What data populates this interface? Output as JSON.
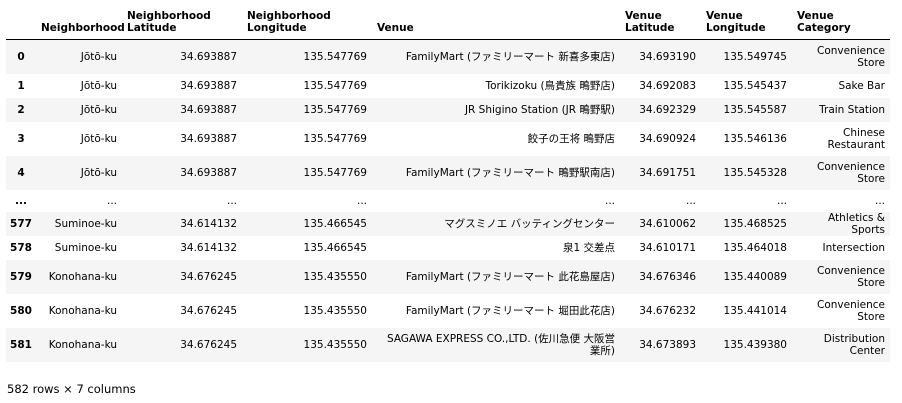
{
  "table": {
    "columns": [
      "",
      "Neighborhood",
      "Neighborhood Latitude",
      "Neighborhood Longitude",
      "Venue",
      "Venue Latitude",
      "Venue Longitude",
      "Venue Category"
    ],
    "rows": [
      {
        "idx": "0",
        "neighborhood": "Jōtō-ku",
        "n_lat": "34.693887",
        "n_lon": "135.547769",
        "venue": "FamilyMart (ファミリーマート 新喜多東店)",
        "v_lat": "34.693190",
        "v_lon": "135.549745",
        "category": "Convenience Store"
      },
      {
        "idx": "1",
        "neighborhood": "Jōtō-ku",
        "n_lat": "34.693887",
        "n_lon": "135.547769",
        "venue": "Torikizoku (鳥貴族 鴫野店)",
        "v_lat": "34.692083",
        "v_lon": "135.545437",
        "category": "Sake Bar"
      },
      {
        "idx": "2",
        "neighborhood": "Jōtō-ku",
        "n_lat": "34.693887",
        "n_lon": "135.547769",
        "venue": "JR Shigino Station (JR 鴫野駅)",
        "v_lat": "34.692329",
        "v_lon": "135.545587",
        "category": "Train Station"
      },
      {
        "idx": "3",
        "neighborhood": "Jōtō-ku",
        "n_lat": "34.693887",
        "n_lon": "135.547769",
        "venue": "餃子の王将 鴫野店",
        "v_lat": "34.690924",
        "v_lon": "135.546136",
        "category": "Chinese Restaurant"
      },
      {
        "idx": "4",
        "neighborhood": "Jōtō-ku",
        "n_lat": "34.693887",
        "n_lon": "135.547769",
        "venue": "FamilyMart (ファミリーマート 鴫野駅南店)",
        "v_lat": "34.691751",
        "v_lon": "135.545328",
        "category": "Convenience Store"
      },
      {
        "idx": "...",
        "neighborhood": "...",
        "n_lat": "...",
        "n_lon": "...",
        "venue": "...",
        "v_lat": "...",
        "v_lon": "...",
        "category": "..."
      },
      {
        "idx": "577",
        "neighborhood": "Suminoe-ku",
        "n_lat": "34.614132",
        "n_lon": "135.466545",
        "venue": "マグスミノエ バッティングセンター",
        "v_lat": "34.610062",
        "v_lon": "135.468525",
        "category": "Athletics & Sports"
      },
      {
        "idx": "578",
        "neighborhood": "Suminoe-ku",
        "n_lat": "34.614132",
        "n_lon": "135.466545",
        "venue": "泉1 交差点",
        "v_lat": "34.610171",
        "v_lon": "135.464018",
        "category": "Intersection"
      },
      {
        "idx": "579",
        "neighborhood": "Konohana-ku",
        "n_lat": "34.676245",
        "n_lon": "135.435550",
        "venue": "FamilyMart (ファミリーマート 此花島屋店)",
        "v_lat": "34.676346",
        "v_lon": "135.440089",
        "category": "Convenience Store"
      },
      {
        "idx": "580",
        "neighborhood": "Konohana-ku",
        "n_lat": "34.676245",
        "n_lon": "135.435550",
        "venue": "FamilyMart (ファミリーマート 堀田此花店)",
        "v_lat": "34.676232",
        "v_lon": "135.441014",
        "category": "Convenience Store"
      },
      {
        "idx": "581",
        "neighborhood": "Konohana-ku",
        "n_lat": "34.676245",
        "n_lon": "135.435550",
        "venue": "SAGAWA EXPRESS CO.,LTD. (佐川急便 大阪営業所)",
        "v_lat": "34.673893",
        "v_lon": "135.439380",
        "category": "Distribution Center"
      }
    ]
  },
  "footer": {
    "shape_text": "582 rows × 7 columns"
  }
}
